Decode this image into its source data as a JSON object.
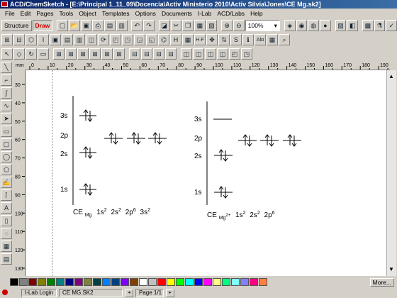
{
  "window": {
    "title": "ACD/ChemSketch - [E:\\Principal 1_11_09\\Docencia\\Activ Ministerio 2010\\Activ Silvia\\Jones\\CE Mg.sk2]"
  },
  "menu": [
    "File",
    "Edit",
    "Pages",
    "Tools",
    "Object",
    "Templates",
    "Options",
    "Documents",
    "I-Lab",
    "ACD/Labs",
    "Help"
  ],
  "toolbar": {
    "structure_label": "Structure",
    "draw_label": "Draw",
    "zoom_value": "100%"
  },
  "ruler": {
    "unit": "mm",
    "h_ticks": [
      "0",
      "10",
      "20",
      "30",
      "40",
      "50",
      "60",
      "70",
      "80",
      "90",
      "100",
      "110",
      "120",
      "130",
      "140",
      "150",
      "160",
      "170",
      "180",
      "190"
    ],
    "v_ticks": [
      "30",
      "40",
      "50",
      "60",
      "70",
      "80",
      "90",
      "100",
      "110",
      "120",
      "130"
    ]
  },
  "diagram1": {
    "levels": [
      "3s",
      "2p",
      "2s",
      "1s"
    ],
    "config_prefix": "CE",
    "config_sub": "Mg",
    "config_terms": [
      {
        "base": "1s",
        "sup": "2"
      },
      {
        "base": "2s",
        "sup": "2"
      },
      {
        "base": "2p",
        "sup": "6"
      },
      {
        "base": "3s",
        "sup": "2"
      }
    ]
  },
  "diagram2": {
    "levels": [
      "3s",
      "2p",
      "2s",
      "1s"
    ],
    "config_prefix": "CE",
    "config_sub": "Mg",
    "config_sub_sup": "2+",
    "config_terms": [
      {
        "base": "1s",
        "sup": "2"
      },
      {
        "base": "2s",
        "sup": "2"
      },
      {
        "base": "2p",
        "sup": "6"
      }
    ]
  },
  "palette_colors": [
    "#000000",
    "#808080",
    "#800000",
    "#808000",
    "#008000",
    "#008080",
    "#000080",
    "#800080",
    "#808040",
    "#004040",
    "#0080ff",
    "#004080",
    "#8000ff",
    "#804000",
    "#ffffff",
    "#c0c0c0",
    "#ff0000",
    "#ffff00",
    "#00ff00",
    "#00ffff",
    "#0000ff",
    "#ff00ff",
    "#ffff80",
    "#00ff80",
    "#80ffff",
    "#8080ff",
    "#ff0080",
    "#ff8040"
  ],
  "palette_more_label": "More...",
  "status": {
    "ilab_label": "I-Lab Login",
    "doc_label": "CE MG.SK2",
    "page_label": "Page 1/1"
  }
}
